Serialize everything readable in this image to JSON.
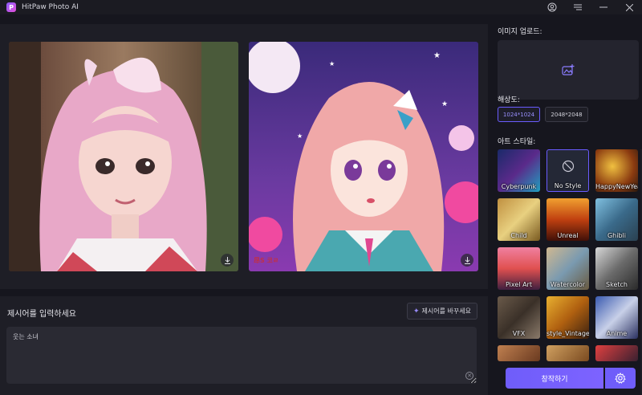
{
  "app": {
    "title": "HitPaw Photo AI",
    "logo_letter": "P"
  },
  "window_controls": [
    {
      "name": "account-icon",
      "glyph": "◯"
    },
    {
      "name": "menu-icon",
      "glyph": "☰"
    },
    {
      "name": "minimize-icon",
      "glyph": "—"
    },
    {
      "name": "close-icon",
      "glyph": "✕"
    }
  ],
  "images": {
    "right_watermark": "昂S 코ㄹ",
    "download_icon": "download-icon"
  },
  "prompt": {
    "label": "제시어를 입력하세요",
    "rewrite_button": "제시어를 바꾸세요",
    "value": "웃는 소녀"
  },
  "upload": {
    "label": "이미지 업로드:"
  },
  "resolution": {
    "label": "해상도:",
    "options": [
      "1024*1024",
      "2048*2048"
    ],
    "selected": "1024*1024"
  },
  "art_style": {
    "label": "아트 스타일:",
    "items": [
      {
        "label": "Cyberpunk"
      },
      {
        "label": "No Style"
      },
      {
        "label": "HappyNewYear"
      },
      {
        "label": "Child"
      },
      {
        "label": "Unreal"
      },
      {
        "label": "Ghibli"
      },
      {
        "label": "Pixel Art"
      },
      {
        "label": "Watercolor"
      },
      {
        "label": "Sketch"
      },
      {
        "label": "VFX"
      },
      {
        "label": "style_Vintage"
      },
      {
        "label": "Anime"
      },
      {
        "label": ""
      },
      {
        "label": ""
      },
      {
        "label": ""
      }
    ],
    "selected": "No Style"
  },
  "actions": {
    "create_button": "창작하기"
  },
  "colors": {
    "accent": "#6f5dfa",
    "panel": "#1e1e26",
    "background": "#16161e"
  }
}
